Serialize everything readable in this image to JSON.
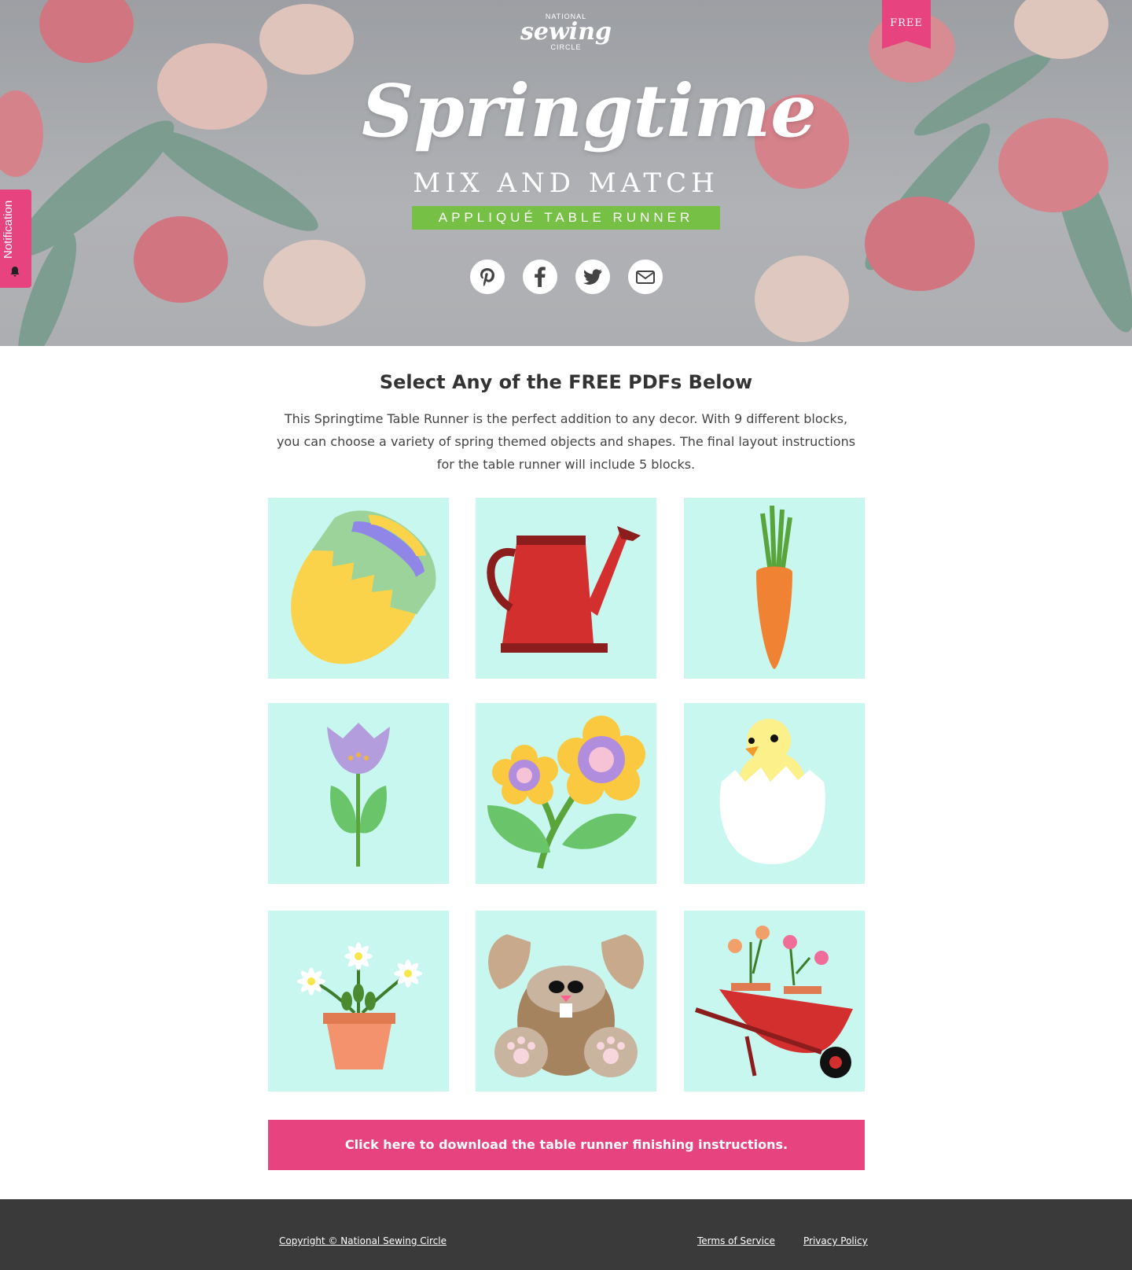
{
  "hero": {
    "logo_top": "NATIONAL",
    "logo_script": "sewing",
    "logo_bottom": "CIRCLE",
    "ribbon": "FREE",
    "title": "Springtime",
    "subtitle": "MIX AND MATCH",
    "band": "APPLIQUÉ TABLE RUNNER",
    "social": [
      "pinterest-icon",
      "facebook-icon",
      "twitter-icon",
      "email-icon"
    ]
  },
  "notification": {
    "label": "Notification"
  },
  "content": {
    "heading": "Select Any of the FREE PDFs Below",
    "intro": "This Springtime Table Runner is the perfect addition to any decor. With 9 different blocks, you can choose a variety of spring themed objects and shapes. The final layout instructions for the table runner will include 5 blocks.",
    "blocks": [
      "easter-egg",
      "watering-can",
      "carrot",
      "tulip",
      "flowers",
      "chick-in-egg",
      "potted-daisies",
      "bunny",
      "wheelbarrow"
    ],
    "download_label": "Click here to download the table runner finishing instructions."
  },
  "colors": {
    "accent_pink": "#e7437e",
    "band_green": "#76c045",
    "tile_bg": "#c8f7f0",
    "footer": "#3a3a3a"
  },
  "footer": {
    "copyright": "Copyright © National Sewing Circle",
    "terms": "Terms of Service",
    "privacy": "Privacy Policy"
  }
}
